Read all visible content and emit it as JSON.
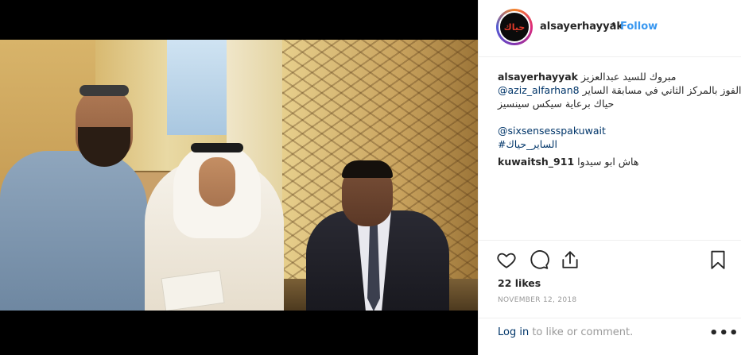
{
  "header": {
    "username": "alsayerhayyak",
    "separator": "•",
    "follow_label": "Follow",
    "avatar_text": "حياك"
  },
  "caption": {
    "username": "alsayerhayyak",
    "line1": "مبروك للسيد عبدالعزيز",
    "line2_text": "الفوز بالمركز الثاني في مسابقة الساير",
    "line2_mention": "@aziz_alfarhan8",
    "line3": "حياك برعاية سيكس سينسيز",
    "mention2": "@sixsensesspakuwait",
    "hashtag": "#الساير_حياك"
  },
  "comment": {
    "username": "kuwaitsh_911",
    "text": "هاش ابو سيدوا"
  },
  "actions": {
    "like_icon": "heart-icon",
    "comment_icon": "comment-icon",
    "share_icon": "share-icon",
    "save_icon": "bookmark-icon"
  },
  "likes": "22 likes",
  "date": "NOVEMBER 12, 2018",
  "footer": {
    "login_label": "Log in",
    "login_suffix": " to like or comment.",
    "more_label": "•••"
  },
  "colors": {
    "accent_blue": "#3897f0",
    "link_blue": "#003569",
    "muted_gray": "#999999",
    "text": "#262626"
  }
}
